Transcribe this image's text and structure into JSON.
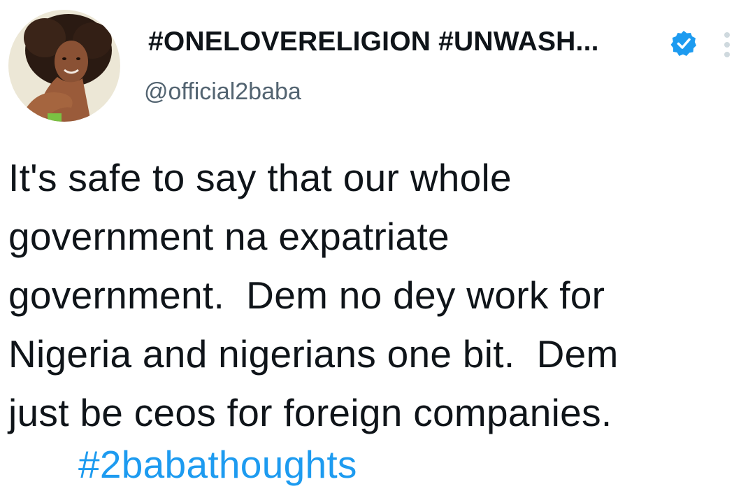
{
  "tweet": {
    "author": {
      "display_name": "#ONELOVERELIGION #UNWASH...",
      "handle": "@official2baba",
      "verified": true,
      "avatar_icon": "profile-photo"
    },
    "text_lines": [
      "It's safe to say that our whole",
      "government na expatriate",
      "government.  Dem no dey work for",
      "Nigeria and nigerians one bit.  Dem",
      "just be ceos for foreign companies."
    ],
    "hashtag": "#2babathoughts",
    "icons": {
      "verified": "verified-badge-icon",
      "more": "more-vertical-icon"
    },
    "colors": {
      "text": "#0f1419",
      "handle": "#536471",
      "link": "#1d9bf0",
      "verified": "#1d9bf0"
    }
  }
}
